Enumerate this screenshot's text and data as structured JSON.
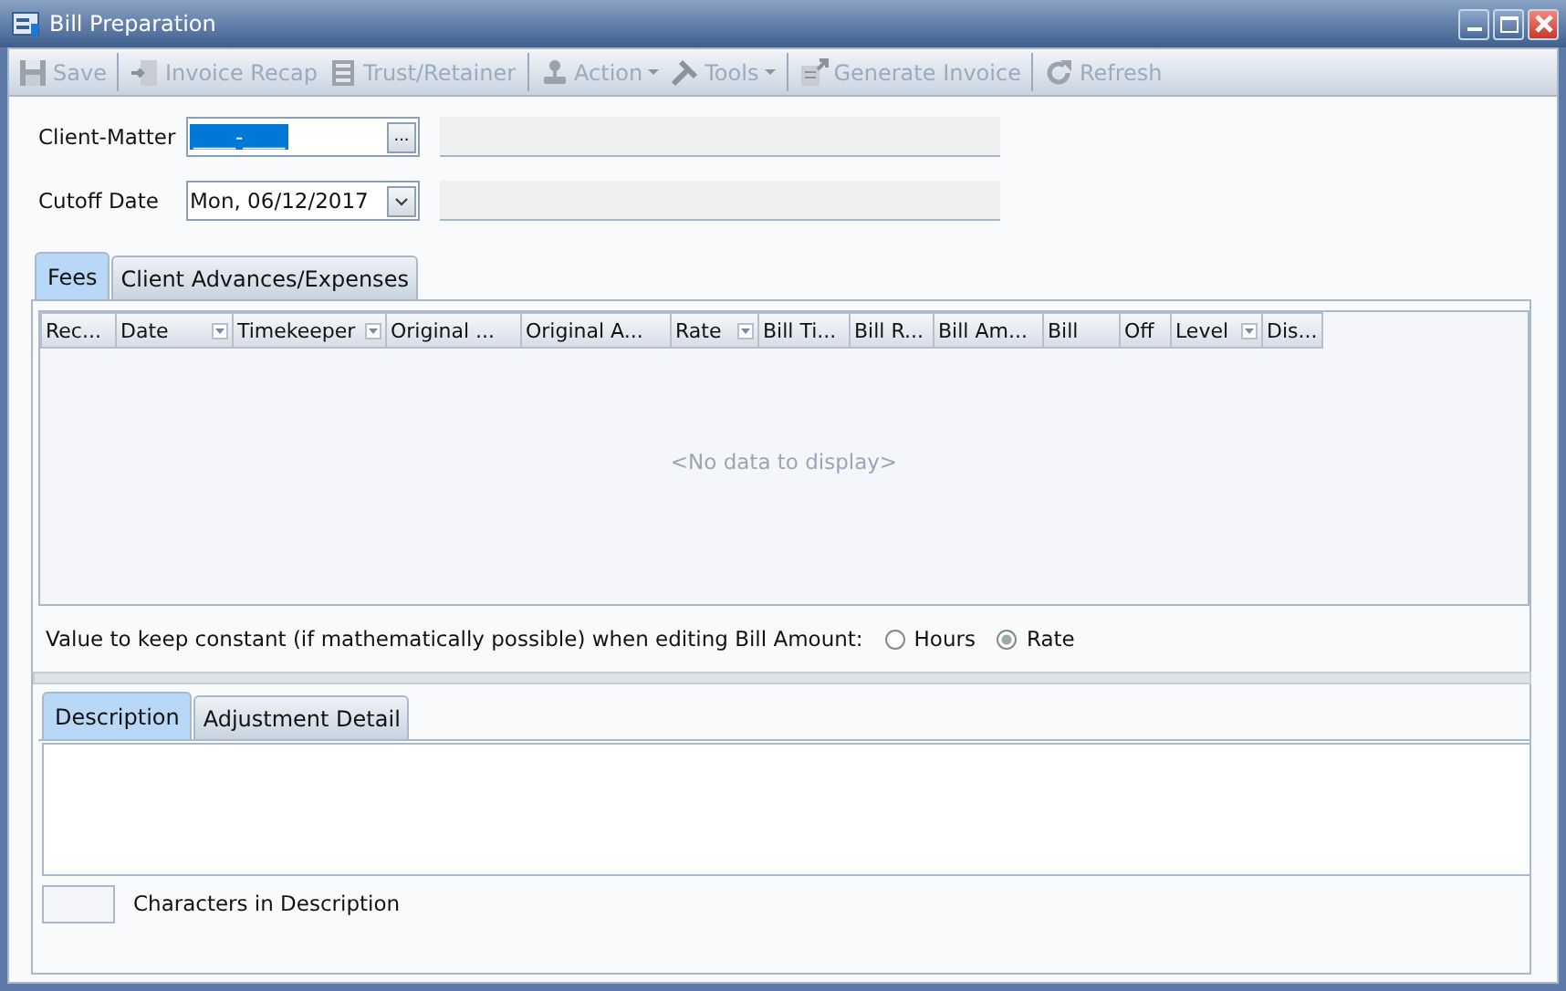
{
  "window": {
    "title": "Bill Preparation"
  },
  "toolbar": [
    {
      "label": "Save",
      "kind": "save",
      "disabled": true,
      "dropdown": false
    },
    {
      "label": "Invoice Recap",
      "kind": "recap",
      "disabled": true,
      "dropdown": false
    },
    {
      "label": "Trust/Retainer",
      "kind": "trust",
      "disabled": true,
      "dropdown": false
    },
    {
      "label": "Action",
      "kind": "action",
      "disabled": true,
      "dropdown": true
    },
    {
      "label": "Tools",
      "kind": "tools",
      "disabled": true,
      "dropdown": true
    },
    {
      "label": "Generate Invoice",
      "kind": "generate",
      "disabled": true,
      "dropdown": false
    },
    {
      "label": "Refresh",
      "kind": "refresh",
      "disabled": true,
      "dropdown": false
    }
  ],
  "client_matter": {
    "label": "Client-Matter",
    "value": "____-____",
    "button": "..."
  },
  "cutoff_date": {
    "label": "Cutoff Date",
    "value": "Mon, 06/12/2017"
  },
  "upper_tabs": [
    {
      "label": "Fees",
      "selected": true
    },
    {
      "label": "Client Advances/Expenses",
      "selected": false
    }
  ],
  "table": {
    "columns": [
      {
        "label": "Rec...",
        "filter": false
      },
      {
        "label": "Date",
        "filter": true
      },
      {
        "label": "Timekeeper",
        "filter": true
      },
      {
        "label": "Original ...",
        "filter": false
      },
      {
        "label": "Original A...",
        "filter": false
      },
      {
        "label": "Rate",
        "filter": true
      },
      {
        "label": "Bill Ti...",
        "filter": false
      },
      {
        "label": "Bill R...",
        "filter": false
      },
      {
        "label": "Bill Am...",
        "filter": false
      },
      {
        "label": "Bill",
        "filter": false
      },
      {
        "label": "Off",
        "filter": false
      },
      {
        "label": "Level",
        "filter": true
      },
      {
        "label": "Dis...",
        "filter": false
      }
    ],
    "empty_text": "<No data to display>"
  },
  "constant": {
    "label": "Value to keep constant (if mathematically possible)  when editing Bill Amount:",
    "options": [
      {
        "label": "Hours",
        "selected": false
      },
      {
        "label": "Rate",
        "selected": true
      }
    ]
  },
  "lower_tabs": [
    {
      "label": "Description",
      "selected": true
    },
    {
      "label": "Adjustment Detail",
      "selected": false
    }
  ],
  "footer": {
    "label": "Characters in Description"
  }
}
